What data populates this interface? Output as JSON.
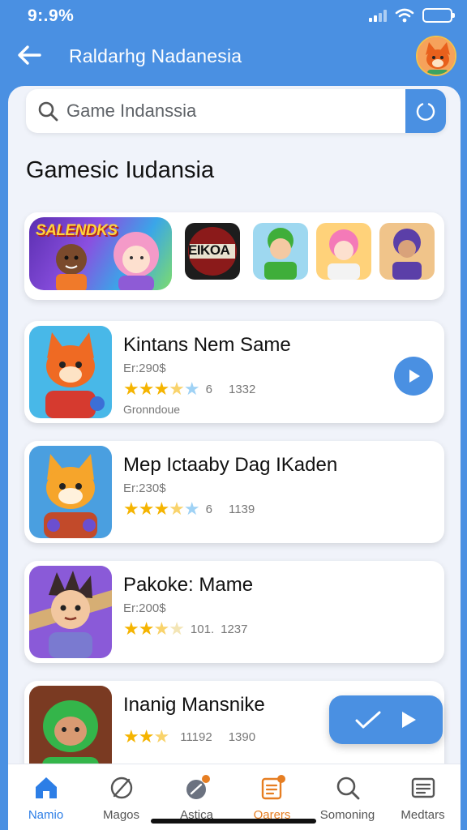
{
  "status_bar": {
    "time": "9:.9%"
  },
  "header": {
    "title": "Raldarhg Nadanesia"
  },
  "search": {
    "placeholder": "Game Indanssia"
  },
  "section": {
    "title": "Gamesic Iudansia"
  },
  "featured": {
    "banner_logo": "SALENDKS",
    "thumb_label": "EIKOA"
  },
  "games": [
    {
      "title": "Kintans Nem Same",
      "price": "Er:290$",
      "rating_num": "6",
      "rating_count": "1332",
      "genre": "Gronndoue"
    },
    {
      "title": "Mep Ictaaby Dag IKaden",
      "price": "Er:230$",
      "rating_num": "6",
      "rating_count": "1139"
    },
    {
      "title": "Pakoke: Mame",
      "price": "Er:200$",
      "rating_num": "101.",
      "rating_count": "1237"
    },
    {
      "title": "Inanig Mansnike",
      "rating_num": "11192",
      "rating_count": "1390"
    }
  ],
  "nav": [
    {
      "label": "Namio",
      "icon": "home-icon"
    },
    {
      "label": "Magos",
      "icon": "compass-icon"
    },
    {
      "label": "Astica",
      "icon": "globe-icon"
    },
    {
      "label": "Oarers",
      "icon": "document-icon"
    },
    {
      "label": "Somoning",
      "icon": "search-icon"
    },
    {
      "label": "Medtars",
      "icon": "list-icon"
    }
  ],
  "colors": {
    "accent": "#4a90e2",
    "background": "#f0f3fa",
    "active_nav": "#2d7ee6",
    "highlight_nav": "#e67e22",
    "star": "#f5b400"
  }
}
